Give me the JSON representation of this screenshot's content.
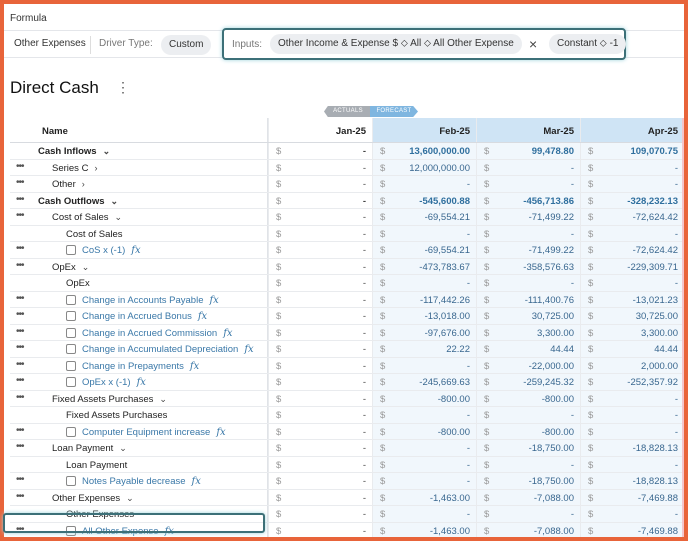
{
  "formula": {
    "label": "Formula",
    "name": "Other Expenses",
    "driver_type_label": "Driver Type:",
    "driver_type_value": "Custom",
    "inputs_label": "Inputs:",
    "input_chip": "Other Income & Expense $ ⬦ All ⬦ All Other Expense",
    "constant_chip": "Constant ⬦ -1",
    "close_icon": "×"
  },
  "page": {
    "title": "Direct Cash",
    "menu_icon": "⋮"
  },
  "tags": {
    "actuals": "ACTUALS",
    "forecast": "FORECAST"
  },
  "columns": {
    "name": "Name",
    "months": [
      "Jan-25",
      "Feb-25",
      "Mar-25",
      "Apr-25"
    ],
    "currency": "$"
  },
  "rows": [
    {
      "label": "Cash Inflows",
      "indent": 0,
      "bold": true,
      "dots": false,
      "chev": "down",
      "values": [
        "-",
        "13,600,000.00",
        "99,478.80",
        "109,070.75"
      ]
    },
    {
      "label": "Series C",
      "indent": 1,
      "bold": false,
      "dots": true,
      "chev": "right",
      "values": [
        "-",
        "12,000,000.00",
        "-",
        "-"
      ]
    },
    {
      "label": "Other",
      "indent": 1,
      "bold": false,
      "dots": true,
      "chev": "right",
      "values": [
        "-",
        "-",
        "-",
        "-"
      ]
    },
    {
      "label": "Cash Outflows",
      "indent": 0,
      "bold": true,
      "dots": true,
      "chev": "down",
      "values": [
        "-",
        "-545,600.88",
        "-456,713.86",
        "-328,232.13"
      ]
    },
    {
      "label": "Cost of Sales",
      "indent": 1,
      "bold": false,
      "dots": true,
      "chev": "down",
      "values": [
        "-",
        "-69,554.21",
        "-71,499.22",
        "-72,624.42"
      ]
    },
    {
      "label": "Cost of Sales",
      "indent": 2,
      "bold": false,
      "dots": false,
      "chev": "",
      "values": [
        "-",
        "-",
        "-",
        "-"
      ]
    },
    {
      "label": "CoS x (-1)",
      "indent": 2,
      "bold": false,
      "dots": true,
      "checkbox": true,
      "link": true,
      "fx": true,
      "values": [
        "-",
        "-69,554.21",
        "-71,499.22",
        "-72,624.42"
      ]
    },
    {
      "label": "OpEx",
      "indent": 1,
      "bold": false,
      "dots": true,
      "chev": "down",
      "values": [
        "-",
        "-473,783.67",
        "-358,576.63",
        "-229,309.71"
      ]
    },
    {
      "label": "OpEx",
      "indent": 2,
      "bold": false,
      "dots": false,
      "chev": "",
      "values": [
        "-",
        "-",
        "-",
        "-"
      ]
    },
    {
      "label": "Change in Accounts Payable",
      "indent": 2,
      "bold": false,
      "dots": true,
      "checkbox": true,
      "link": true,
      "fx": true,
      "values": [
        "-",
        "-117,442.26",
        "-111,400.76",
        "-13,021.23"
      ]
    },
    {
      "label": "Change in Accrued Bonus",
      "indent": 2,
      "bold": false,
      "dots": true,
      "checkbox": true,
      "link": true,
      "fx": true,
      "values": [
        "-",
        "-13,018.00",
        "30,725.00",
        "30,725.00"
      ]
    },
    {
      "label": "Change in Accrued Commission",
      "indent": 2,
      "bold": false,
      "dots": true,
      "checkbox": true,
      "link": true,
      "fx": true,
      "values": [
        "-",
        "-97,676.00",
        "3,300.00",
        "3,300.00"
      ]
    },
    {
      "label": "Change in Accumulated Depreciation",
      "indent": 2,
      "bold": false,
      "dots": true,
      "checkbox": true,
      "link": true,
      "fx": true,
      "values": [
        "-",
        "22.22",
        "44.44",
        "44.44"
      ]
    },
    {
      "label": "Change in Prepayments",
      "indent": 2,
      "bold": false,
      "dots": true,
      "checkbox": true,
      "link": true,
      "fx": true,
      "values": [
        "-",
        "-",
        "-22,000.00",
        "2,000.00"
      ]
    },
    {
      "label": "OpEx x (-1)",
      "indent": 2,
      "bold": false,
      "dots": true,
      "checkbox": true,
      "link": true,
      "fx": true,
      "values": [
        "-",
        "-245,669.63",
        "-259,245.32",
        "-252,357.92"
      ]
    },
    {
      "label": "Fixed Assets Purchases",
      "indent": 1,
      "bold": false,
      "dots": true,
      "chev": "down",
      "values": [
        "-",
        "-800.00",
        "-800.00",
        "-"
      ]
    },
    {
      "label": "Fixed Assets Purchases",
      "indent": 2,
      "bold": false,
      "dots": false,
      "chev": "",
      "values": [
        "-",
        "-",
        "-",
        "-"
      ]
    },
    {
      "label": "Computer Equipment increase",
      "indent": 2,
      "bold": false,
      "dots": true,
      "checkbox": true,
      "link": true,
      "fx": true,
      "values": [
        "-",
        "-800.00",
        "-800.00",
        "-"
      ]
    },
    {
      "label": "Loan Payment",
      "indent": 1,
      "bold": false,
      "dots": true,
      "chev": "down",
      "values": [
        "-",
        "-",
        "-18,750.00",
        "-18,828.13"
      ]
    },
    {
      "label": "Loan Payment",
      "indent": 2,
      "bold": false,
      "dots": false,
      "chev": "",
      "values": [
        "-",
        "-",
        "-",
        "-"
      ]
    },
    {
      "label": "Notes Payable decrease",
      "indent": 2,
      "bold": false,
      "dots": true,
      "checkbox": true,
      "link": true,
      "fx": true,
      "values": [
        "-",
        "-",
        "-18,750.00",
        "-18,828.13"
      ]
    },
    {
      "label": "Other Expenses",
      "indent": 1,
      "bold": false,
      "dots": true,
      "chev": "down",
      "values": [
        "-",
        "-1,463.00",
        "-7,088.00",
        "-7,469.88"
      ]
    },
    {
      "label": "Other Expenses",
      "indent": 2,
      "bold": false,
      "dots": false,
      "chev": "",
      "values": [
        "-",
        "-",
        "-",
        "-"
      ]
    },
    {
      "label": "All Other Expense",
      "indent": 2,
      "bold": false,
      "dots": true,
      "checkbox": true,
      "link": true,
      "fx": true,
      "values": [
        "-",
        "-1,463.00",
        "-7,088.00",
        "-7,469.88"
      ]
    }
  ],
  "icons": {
    "fx": "fx",
    "dots": "•••",
    "chev_down": "⌄",
    "chev_right": "›"
  }
}
